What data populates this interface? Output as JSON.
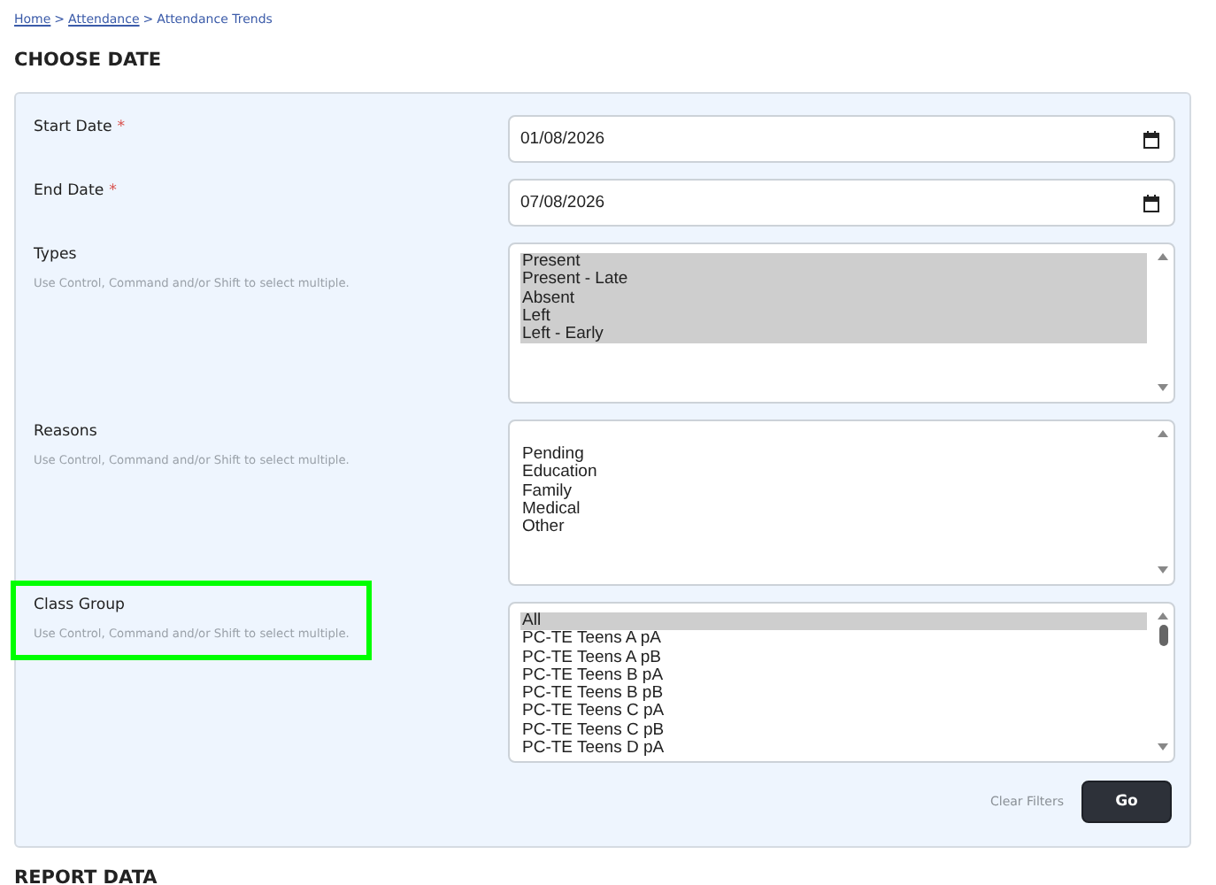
{
  "breadcrumb": [
    {
      "label": "Home",
      "link": true,
      "separator": ">"
    },
    {
      "label": "Attendance",
      "link": true,
      "separator": ">"
    },
    {
      "label": "Attendance Trends",
      "link": false
    }
  ],
  "heading": "CHOOSE DATE",
  "fields": [
    {
      "kind": "date",
      "label": "Start Date",
      "required_mark": "*",
      "value": "01/08/2026",
      "highlighted": false
    },
    {
      "kind": "date",
      "label": "End Date",
      "required_mark": "*",
      "value": "07/08/2026",
      "highlighted": false
    },
    {
      "kind": "multiselect",
      "label": "Types",
      "hint": "Use Control, Command and/or Shift to select multiple.",
      "highlighted": false,
      "scrollbar_thumb": false,
      "options": [
        {
          "label": "Present",
          "selected": true
        },
        {
          "label": "Present - Late",
          "selected": true
        },
        {
          "label": "Absent",
          "selected": true
        },
        {
          "label": "Left",
          "selected": true
        },
        {
          "label": "Left - Early",
          "selected": true
        }
      ]
    },
    {
      "kind": "multiselect",
      "label": "Reasons",
      "hint": "Use Control, Command and/or Shift to select multiple.",
      "highlighted": false,
      "scrollbar_thumb": false,
      "options": [
        {
          "label": "Pending",
          "selected": false
        },
        {
          "label": "Education",
          "selected": false
        },
        {
          "label": "Family",
          "selected": false
        },
        {
          "label": "Medical",
          "selected": false
        },
        {
          "label": "Other",
          "selected": false
        }
      ]
    },
    {
      "kind": "multiselect",
      "label": "Class Group",
      "hint": "Use Control, Command and/or Shift to select multiple.",
      "highlighted": true,
      "scrollbar_thumb": true,
      "options": [
        {
          "label": "All",
          "selected": true
        },
        {
          "label": "PC-TE Teens A pA",
          "selected": false
        },
        {
          "label": "PC-TE Teens A pB",
          "selected": false
        },
        {
          "label": "PC-TE Teens B pA",
          "selected": false
        },
        {
          "label": "PC-TE Teens B pB",
          "selected": false
        },
        {
          "label": "PC-TE Teens C pA",
          "selected": false
        },
        {
          "label": "PC-TE Teens C pB",
          "selected": false
        },
        {
          "label": "PC-TE Teens D pA",
          "selected": false
        }
      ]
    }
  ],
  "actions": {
    "clear": "Clear Filters",
    "submit": "Go"
  },
  "next_heading": "REPORT DATA"
}
